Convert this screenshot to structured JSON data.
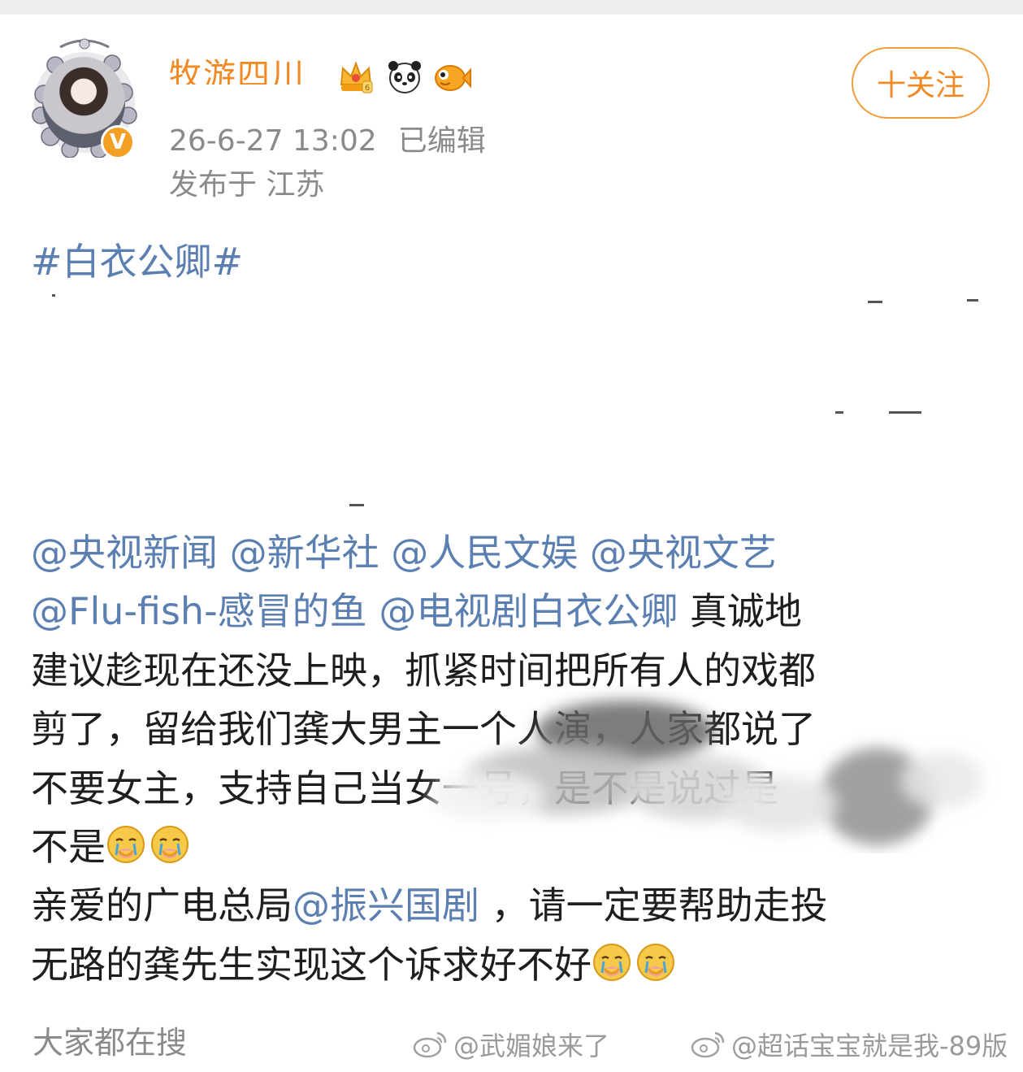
{
  "post": {
    "username": "牧游四川",
    "timestamp": "26-6-27 13:02",
    "edited": "已编辑",
    "location": "发布于 江苏",
    "follow_label": "十关注",
    "topic": "#白衣公卿#"
  },
  "body": {
    "line1": [
      "@央视新闻",
      "@新华社",
      "@人民文娱",
      "@央视文艺"
    ],
    "line2_mentions": [
      "@Flu-fish-感冒的鱼",
      "@电视剧白衣公卿"
    ],
    "line2_text": " 真诚地",
    "line3": "建议趁现在还没上映，抓紧时间把所有人的戏都",
    "line4": "剪了，留给我们龚大男主一个人演，人家都说了",
    "line5": "不要女主，支持自己当女一号，是不是说过是",
    "line6": "不是",
    "line7_before": "亲爱的广电总局",
    "line7_mention": "@振兴国剧",
    "line7_after": " ，请一定要帮助走投",
    "line8": "无路的龚先生实现这个诉求好不好"
  },
  "footer": {
    "search_label": "大家都在搜",
    "watermark1": "@武媚娘来了",
    "watermark2": "@超话宝宝就是我-89版"
  },
  "icons": {
    "badges": [
      "crown-badge-icon",
      "panda-badge-icon",
      "fish-badge-icon"
    ],
    "emoji": "crying-face-emoji",
    "verified": "verified-badge-icon"
  },
  "colors": {
    "accent": "#f08a24",
    "link": "#5b7fb0",
    "meta": "#8a8a8a",
    "text": "#1e1e1e"
  }
}
